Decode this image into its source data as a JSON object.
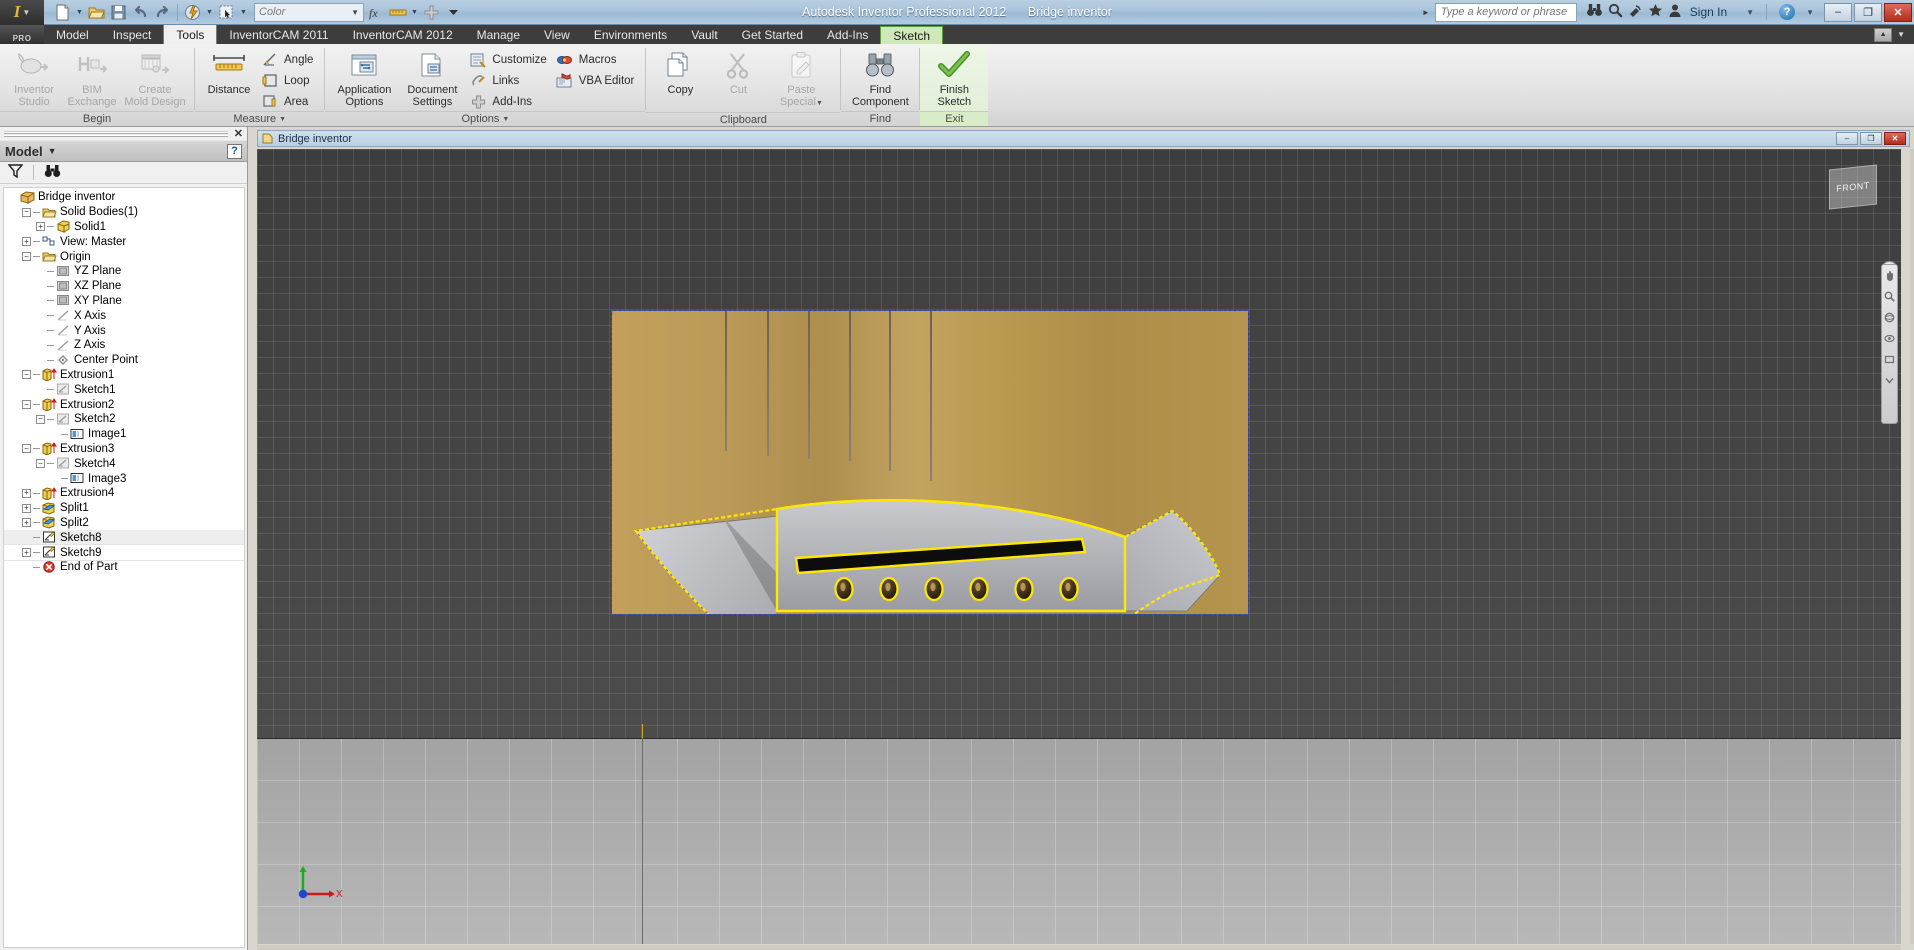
{
  "titlebar": {
    "app_title": "Autodesk Inventor Professional 2012",
    "document_name": "Bridge inventor",
    "logo_text": "PRO",
    "search_placeholder": "Type a keyword or phrase",
    "sign_in_label": "Sign In",
    "color_combo_value": "Color",
    "window_buttons": {
      "minimize": "–",
      "restore": "❐",
      "close": "✕"
    }
  },
  "ribbon_tabs": [
    {
      "label": "Model",
      "state": "normal"
    },
    {
      "label": "Inspect",
      "state": "normal"
    },
    {
      "label": "Tools",
      "state": "active"
    },
    {
      "label": "InventorCAM 2011",
      "state": "normal"
    },
    {
      "label": "InventorCAM 2012",
      "state": "normal"
    },
    {
      "label": "Manage",
      "state": "normal"
    },
    {
      "label": "View",
      "state": "normal"
    },
    {
      "label": "Environments",
      "state": "normal"
    },
    {
      "label": "Vault",
      "state": "normal"
    },
    {
      "label": "Get Started",
      "state": "normal"
    },
    {
      "label": "Add-Ins",
      "state": "normal"
    },
    {
      "label": "Sketch",
      "state": "contextual"
    }
  ],
  "ribbon_groups": [
    {
      "name": "Begin",
      "label": "Begin",
      "has_caret": false,
      "big_buttons": [
        {
          "label_line1": "Inventor",
          "label_line2": "Studio",
          "icon": "inventor-studio-icon",
          "disabled": true
        },
        {
          "label_line1": "BIM",
          "label_line2": "Exchange",
          "icon": "bim-exchange-icon",
          "disabled": true
        },
        {
          "label_line1": "Create",
          "label_line2": "Mold Design",
          "icon": "create-mold-design-icon",
          "disabled": true
        }
      ],
      "small_buttons": []
    },
    {
      "name": "Measure",
      "label": "Measure",
      "has_caret": true,
      "big_buttons": [
        {
          "label_line1": "Distance",
          "label_line2": "",
          "icon": "measure-distance-icon",
          "disabled": false
        }
      ],
      "small_buttons": [
        {
          "label": "Angle",
          "icon": "measure-angle-icon"
        },
        {
          "label": "Loop",
          "icon": "measure-loop-icon"
        },
        {
          "label": "Area",
          "icon": "measure-area-icon"
        }
      ]
    },
    {
      "name": "Options",
      "label": "Options",
      "has_caret": true,
      "big_buttons": [
        {
          "label_line1": "Application",
          "label_line2": "Options",
          "icon": "application-options-icon",
          "disabled": false
        },
        {
          "label_line1": "Document",
          "label_line2": "Settings",
          "icon": "document-settings-icon",
          "disabled": false
        }
      ],
      "small_buttons": [
        {
          "label": "Customize",
          "icon": "customize-icon"
        },
        {
          "label": "Links",
          "icon": "links-icon"
        },
        {
          "label": "Add-Ins",
          "icon": "add-ins-icon"
        },
        {
          "label": "Macros",
          "icon": "macros-icon"
        },
        {
          "label": "VBA Editor",
          "icon": "vba-editor-icon"
        }
      ]
    },
    {
      "name": "Clipboard",
      "label": "Clipboard",
      "has_caret": false,
      "big_buttons": [
        {
          "label_line1": "Copy",
          "label_line2": "",
          "icon": "copy-icon",
          "disabled": false
        },
        {
          "label_line1": "Cut",
          "label_line2": "",
          "icon": "cut-icon",
          "disabled": true
        },
        {
          "label_line1": "Paste",
          "label_line2": "Special",
          "icon": "paste-special-icon",
          "disabled": true
        }
      ],
      "small_buttons": []
    },
    {
      "name": "Find",
      "label": "Find",
      "has_caret": false,
      "big_buttons": [
        {
          "label_line1": "Find",
          "label_line2": "Component",
          "icon": "find-component-icon",
          "disabled": false
        }
      ],
      "small_buttons": []
    },
    {
      "name": "Exit",
      "label": "Exit",
      "has_caret": false,
      "big_buttons": [
        {
          "label_line1": "Finish",
          "label_line2": "Sketch",
          "icon": "finish-sketch-icon",
          "disabled": false
        }
      ],
      "small_buttons": []
    }
  ],
  "browser": {
    "panel_title": "Model",
    "help_glyph": "?",
    "close_glyph": "✕",
    "toolbar_icons": [
      "filter-icon",
      "find-binoculars-icon"
    ],
    "tree": [
      {
        "label": "Bridge inventor",
        "depth": 0,
        "icon": "part-cube-icon",
        "expander": "none",
        "connector": false,
        "highlight": "none"
      },
      {
        "label": "Solid Bodies(1)",
        "depth": 1,
        "icon": "folder-open-icon",
        "expander": "minus",
        "connector": true,
        "highlight": "none"
      },
      {
        "label": "Solid1",
        "depth": 2,
        "icon": "solid-cube-icon",
        "expander": "plus",
        "connector": true,
        "highlight": "none"
      },
      {
        "label": "View: Master",
        "depth": 1,
        "icon": "view-master-icon",
        "expander": "plus",
        "connector": false,
        "highlight": "none"
      },
      {
        "label": "Origin",
        "depth": 1,
        "icon": "folder-open-icon",
        "expander": "minus",
        "connector": false,
        "highlight": "none"
      },
      {
        "label": "YZ Plane",
        "depth": 2,
        "icon": "plane-icon",
        "expander": "none",
        "connector": true,
        "highlight": "none"
      },
      {
        "label": "XZ Plane",
        "depth": 2,
        "icon": "plane-icon",
        "expander": "none",
        "connector": true,
        "highlight": "none"
      },
      {
        "label": "XY Plane",
        "depth": 2,
        "icon": "plane-icon",
        "expander": "none",
        "connector": true,
        "highlight": "none"
      },
      {
        "label": "X Axis",
        "depth": 2,
        "icon": "axis-icon",
        "expander": "none",
        "connector": true,
        "highlight": "none"
      },
      {
        "label": "Y Axis",
        "depth": 2,
        "icon": "axis-icon",
        "expander": "none",
        "connector": true,
        "highlight": "none"
      },
      {
        "label": "Z Axis",
        "depth": 2,
        "icon": "axis-icon",
        "expander": "none",
        "connector": true,
        "highlight": "none"
      },
      {
        "label": "Center Point",
        "depth": 2,
        "icon": "center-point-icon",
        "expander": "none",
        "connector": true,
        "highlight": "none"
      },
      {
        "label": "Extrusion1",
        "depth": 1,
        "icon": "extrusion-icon",
        "expander": "minus",
        "connector": false,
        "highlight": "none"
      },
      {
        "label": "Sketch1",
        "depth": 2,
        "icon": "sketch-icon",
        "expander": "none",
        "connector": true,
        "highlight": "none"
      },
      {
        "label": "Extrusion2",
        "depth": 1,
        "icon": "extrusion-icon",
        "expander": "minus",
        "connector": false,
        "highlight": "none"
      },
      {
        "label": "Sketch2",
        "depth": 2,
        "icon": "sketch-icon",
        "expander": "minus",
        "connector": true,
        "highlight": "none"
      },
      {
        "label": "Image1",
        "depth": 3,
        "icon": "image-icon",
        "expander": "none",
        "connector": true,
        "highlight": "none"
      },
      {
        "label": "Extrusion3",
        "depth": 1,
        "icon": "extrusion-icon",
        "expander": "minus",
        "connector": false,
        "highlight": "none"
      },
      {
        "label": "Sketch4",
        "depth": 2,
        "icon": "sketch-icon",
        "expander": "minus",
        "connector": true,
        "highlight": "none"
      },
      {
        "label": "Image3",
        "depth": 3,
        "icon": "image-icon",
        "expander": "none",
        "connector": true,
        "highlight": "none"
      },
      {
        "label": "Extrusion4",
        "depth": 1,
        "icon": "extrusion-icon",
        "expander": "plus",
        "connector": false,
        "highlight": "none"
      },
      {
        "label": "Split1",
        "depth": 1,
        "icon": "split-icon",
        "expander": "plus",
        "connector": false,
        "highlight": "none"
      },
      {
        "label": "Split2",
        "depth": 1,
        "icon": "split-icon",
        "expander": "plus",
        "connector": false,
        "highlight": "none"
      },
      {
        "label": "Sketch8",
        "depth": 1,
        "icon": "sketch-active-icon",
        "expander": "none",
        "connector": false,
        "highlight": "row"
      },
      {
        "label": "Sketch9",
        "depth": 1,
        "icon": "sketch-active-icon",
        "expander": "plus",
        "connector": false,
        "highlight": "selected"
      },
      {
        "label": "End of Part",
        "depth": 1,
        "icon": "end-of-part-icon",
        "expander": "none",
        "connector": false,
        "highlight": "none"
      }
    ]
  },
  "document_window": {
    "tab_label": "Bridge inventor",
    "buttons": {
      "minimize": "–",
      "restore": "❐",
      "close": "✕"
    }
  },
  "viewport": {
    "view_cube_label": "FRONT",
    "axis_labels": {
      "x": "X",
      "y": "Y"
    },
    "colors": {
      "sketch_highlight": "#ffe800",
      "background_top": "#3d3d3d",
      "ground": "#ababab",
      "image_plane_border": "#3a4fb5",
      "accent_green": "#5f9f3a"
    },
    "model": {
      "description": "Guitar bridge sketch overlay on wood image plane",
      "bridge_pin_count": 6,
      "string_count": 6,
      "saddle_slot": true
    }
  }
}
